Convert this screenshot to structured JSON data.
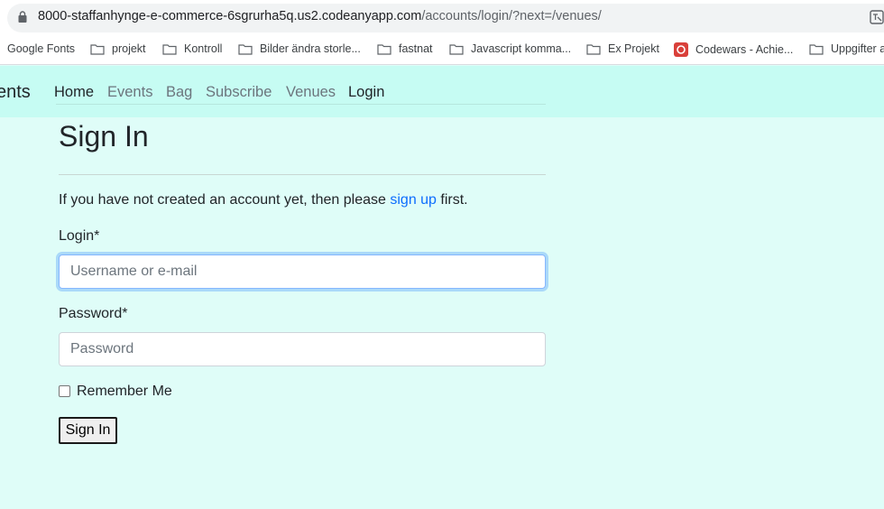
{
  "browser": {
    "url_host": "8000-staffanhynge-e-commerce-6sgrurha5q.us2.codeanyapp.com",
    "url_path": "/accounts/login/?next=/venues/"
  },
  "bookmarks": [
    {
      "label": "Google Fonts",
      "icon": "none"
    },
    {
      "label": "projekt",
      "icon": "folder-icon"
    },
    {
      "label": "Kontroll",
      "icon": "folder-icon"
    },
    {
      "label": "Bilder ändra storle...",
      "icon": "folder-icon"
    },
    {
      "label": "fastnat",
      "icon": "folder-icon"
    },
    {
      "label": "Javascript komma...",
      "icon": "folder-icon"
    },
    {
      "label": "Ex Projekt",
      "icon": "folder-icon"
    },
    {
      "label": "Codewars - Achie...",
      "icon": "codewars-icon"
    },
    {
      "label": "Uppgifter a",
      "icon": "folder-icon"
    }
  ],
  "navbar": {
    "brand": "ents",
    "links": [
      "Home",
      "Events",
      "Bag",
      "Subscribe",
      "Venues",
      "Login"
    ]
  },
  "page": {
    "title": "Sign In",
    "intro_before": "If you have not created an account yet, then please ",
    "intro_link": "sign up",
    "intro_after": " first.",
    "login_label": "Login*",
    "login_placeholder": "Username or e-mail",
    "password_label": "Password*",
    "password_placeholder": "Password",
    "remember_label": "Remember Me",
    "submit_label": "Sign In"
  },
  "colors": {
    "background": "#dffdf8",
    "navbar": "#c6fcf3",
    "link": "#0d6efd"
  }
}
